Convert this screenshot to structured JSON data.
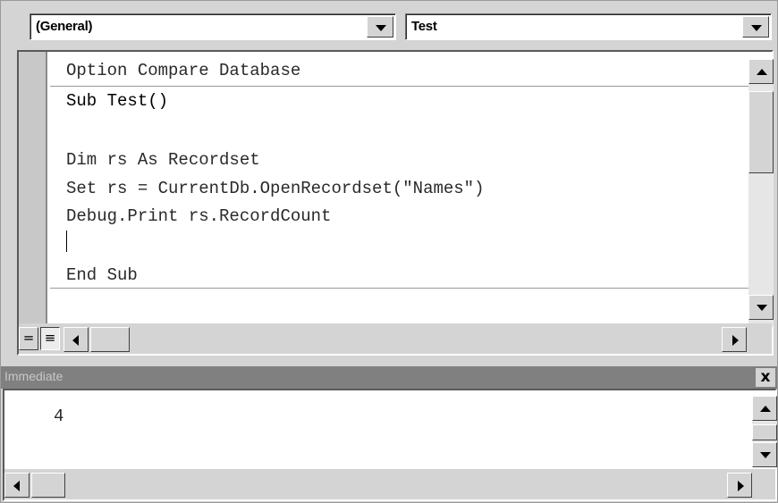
{
  "object_combo": {
    "value": "(General)"
  },
  "procedure_combo": {
    "value": "Test"
  },
  "code_lines": [
    "Option Compare Database",
    "Sub Test()",
    "",
    "Dim rs As Recordset",
    "Set rs = CurrentDb.OpenRecordset(\"Names\")",
    "Debug.Print rs.RecordCount",
    "",
    "End Sub"
  ],
  "view_buttons": {
    "procedure_view_glyph": "=",
    "full_module_view_glyph": "≡"
  },
  "immediate": {
    "title": "Immediate",
    "close_glyph": "x",
    "output": "4"
  },
  "icons": [
    "chevron-down-icon",
    "scroll-up-icon",
    "scroll-down-icon",
    "scroll-left-icon",
    "scroll-right-icon",
    "close-icon"
  ]
}
